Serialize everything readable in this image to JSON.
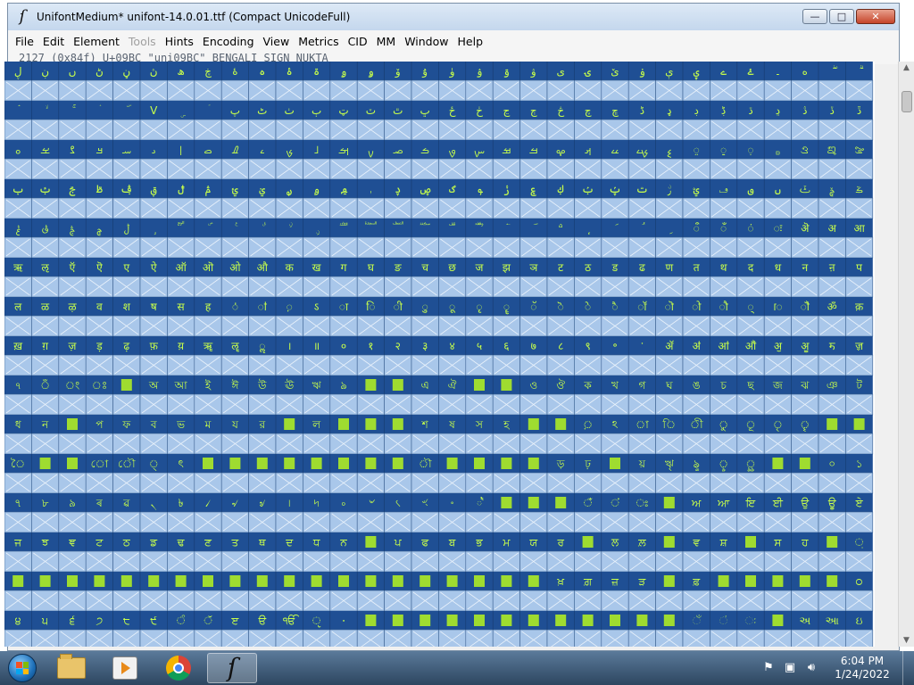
{
  "window": {
    "title": "UnifontMedium*  unifont-14.0.01.ttf (Compact UnicodeFull)",
    "app_icon": "fontforge-icon",
    "controls": {
      "minimize": "—",
      "maximize": "□",
      "close": "✕"
    }
  },
  "menu": [
    {
      "label": "File",
      "enabled": true
    },
    {
      "label": "Edit",
      "enabled": true
    },
    {
      "label": "Element",
      "enabled": true
    },
    {
      "label": "Tools",
      "enabled": false
    },
    {
      "label": "Hints",
      "enabled": true
    },
    {
      "label": "Encoding",
      "enabled": true
    },
    {
      "label": "View",
      "enabled": true
    },
    {
      "label": "Metrics",
      "enabled": true
    },
    {
      "label": "CID",
      "enabled": true
    },
    {
      "label": "MM",
      "enabled": true
    },
    {
      "label": "Window",
      "enabled": true
    },
    {
      "label": "Help",
      "enabled": true
    }
  ],
  "info_line": "2127 (0x84f) U+09BC \"uni09BC\" BENGALI SIGN NUKTA",
  "colors": {
    "row_dark": "#1f4f94",
    "cell_light": "#a9c7ea",
    "glyph_fg": "#c8ff4a",
    "missing_box": "#9fdc30",
    "grid_line": "#3a5f90"
  },
  "grid": {
    "columns": 32,
    "rows": [
      [
        "ڸ",
        "ڹ",
        "ں",
        "ڻ",
        "ڼ",
        "ڽ",
        "ھ",
        "ڿ",
        "ۀ",
        "ہ",
        "ۂ",
        "ۃ",
        "ۄ",
        "ۅ",
        "ۆ",
        "ۇ",
        "ۈ",
        "ۉ",
        "ۊ",
        "ۋ",
        "ی",
        "ۍ",
        "ێ",
        "ۏ",
        "ې",
        "ۑ",
        "ے",
        "ۓ",
        "۔",
        "ە",
        "ۖ",
        "ۗ"
      ],
      [
        "ۘ",
        "ۙ",
        "ۚ",
        "ۛ",
        "ۜ",
        "V",
        "ۣ",
        "ۤ",
        "پ",
        "ٹ",
        "ٺ",
        "ٻ",
        "ټ",
        "ٽ",
        "ٿ",
        "ڀ",
        "ځ",
        "ڂ",
        "ڃ",
        "ڄ",
        "څ",
        "چ",
        "ڇ",
        "ڈ",
        "ډ",
        "ڊ",
        "ڋ",
        "ڌ",
        "ڍ",
        "ڎ",
        "ڏ",
        "ڐ"
      ],
      [
        "ࡀ",
        "ࡁ",
        "ࡂ",
        "ࡃ",
        "ࡄ",
        "ࡅ",
        "ࡆ",
        "ࡇ",
        "ࡈ",
        "ࡉ",
        "ࡊ",
        "ࡋ",
        "ࡌ",
        "ࡍ",
        "ࡎ",
        "ࡏ",
        "ࡐ",
        "ࡑ",
        "ࡒ",
        "ࡓ",
        "ࡔ",
        "ࡕ",
        "ࡖ",
        "ࡗ",
        "ࡘ",
        "࡙",
        "࡚",
        "࡛",
        "࡞",
        "ࡠ",
        "ࡡ",
        "ࡢ"
      ],
      [
        "ࢠ",
        "ࢡ",
        "ࢢ",
        "ࢣ",
        "ࢤ",
        "ࢥ",
        "ࢦ",
        "ࢧ",
        "ࢨ",
        "ࢩ",
        "ࢪ",
        "ࢫ",
        "ࢬ",
        "ࢭ",
        "ࢮ",
        "ࢯ",
        "ࢰ",
        "ࢱ",
        "ࢲ",
        "ࢳ",
        "ࢴ",
        "ࢶ",
        "ࢷ",
        "ࢸ",
        "ࢹ",
        "ࢺ",
        "ࢻ",
        "ࢼ",
        "ࢽ",
        "ࣀ",
        "ࣁ",
        "ࣂ"
      ],
      [
        "ࣃ",
        "ࣄ",
        "ࣅ",
        "ࣆ",
        "ࣇ",
        "࣓",
        "ࣔ",
        "ࣕ",
        "ࣖ",
        "ࣗ",
        "ࣘ",
        "ࣙ",
        "ࣚ",
        "ࣛ",
        "ࣜ",
        "ࣝ",
        "ࣞ",
        "ࣟ",
        "࣠",
        "࣡",
        "࣢",
        "ࣣ",
        "ࣤ",
        "ࣥ",
        "ࣦ",
        "ऀ",
        "ँ",
        "ं",
        "ः",
        "ऄ",
        "अ",
        "आ"
      ],
      [
        "ऋ",
        "ऌ",
        "ऍ",
        "ऎ",
        "ए",
        "ऐ",
        "ऑ",
        "ऒ",
        "ओ",
        "औ",
        "क",
        "ख",
        "ग",
        "घ",
        "ङ",
        "च",
        "छ",
        "ज",
        "झ",
        "ञ",
        "ट",
        "ठ",
        "ड",
        "ढ",
        "ण",
        "त",
        "थ",
        "द",
        "ध",
        "न",
        "ऩ",
        "प"
      ],
      [
        "ल",
        "ळ",
        "ऴ",
        "व",
        "श",
        "ष",
        "स",
        "ह",
        "ऺ",
        "ऻ",
        "़",
        "ऽ",
        "ा",
        "ि",
        "ी",
        "ु",
        "ू",
        "ृ",
        "ॄ",
        "ॅ",
        "ॆ",
        "े",
        "ै",
        "ॉ",
        "ॊ",
        "ो",
        "ौ",
        "्",
        "ॎ",
        "ॏ",
        "ॐ",
        "क़"
      ],
      [
        "ख़",
        "ग़",
        "ज़",
        "ड़",
        "ढ़",
        "फ़",
        "य़",
        "ॠ",
        "ॡ",
        "ॢ",
        "।",
        "॥",
        "०",
        "१",
        "२",
        "३",
        "४",
        "५",
        "६",
        "७",
        "८",
        "९",
        "॰",
        "ॱ",
        "ॲ",
        "ॳ",
        "ॴ",
        "ॵ",
        "ॶ",
        "ॷ",
        "ॸ",
        "ॹ"
      ],
      [
        "ঀ",
        "ঁ",
        "ং",
        "ঃ",
        "",
        "অ",
        "আ",
        "ই",
        "ঈ",
        "উ",
        "ঊ",
        "ঋ",
        "ঌ",
        "",
        "",
        "এ",
        "ঐ",
        "",
        "",
        "ও",
        "ঔ",
        "ক",
        "খ",
        "গ",
        "ঘ",
        "ঙ",
        "চ",
        "ছ",
        "জ",
        "ঝ",
        "ঞ",
        "ট"
      ],
      [
        "ধ",
        "ন",
        "",
        "প",
        "ফ",
        "ব",
        "ভ",
        "ম",
        "য",
        "র",
        "",
        "ল",
        "",
        "",
        "",
        "শ",
        "ষ",
        "স",
        "হ",
        "",
        "",
        "়",
        "ঽ",
        "া",
        "ি",
        "ী",
        "ু",
        "ূ",
        "ৃ",
        "ৄ",
        "",
        "",
        "ে"
      ],
      [
        "ৈ",
        "",
        "",
        "ো",
        "ৌ",
        "্",
        "ৎ",
        "",
        "",
        "",
        "",
        "",
        "",
        "",
        "",
        "ৗ",
        "",
        "",
        "",
        "",
        "ড়",
        "ঢ়",
        "",
        "য়",
        "ৠ",
        "ৡ",
        "ৢ",
        "ৣ",
        "",
        "",
        "০",
        "১"
      ],
      [
        "৭",
        "৮",
        "৯",
        "ৰ",
        "ৱ",
        "৲",
        "৳",
        "৴",
        "৵",
        "৶",
        "৷",
        "৸",
        "৹",
        "৺",
        "৻",
        "ৼ",
        "৽",
        "৾",
        "",
        "",
        "",
        "ਁ",
        "ਂ",
        "ਃ",
        "",
        "ਅ",
        "ਆ",
        "ਇ",
        "ਈ",
        "ਉ",
        "ਊ",
        "ਏ"
      ],
      [
        "ਜ",
        "ਝ",
        "ਞ",
        "ਟ",
        "ਠ",
        "ਡ",
        "ਢ",
        "ਣ",
        "ਤ",
        "ਥ",
        "ਦ",
        "ਧ",
        "ਨ",
        "",
        "ਪ",
        "ਫ",
        "ਬ",
        "ਭ",
        "ਮ",
        "ਯ",
        "ਰ",
        "",
        "ਲ",
        "ਲ਼",
        "",
        "ਵ",
        "ਸ਼",
        "",
        "ਸ",
        "ਹ",
        "",
        "਼"
      ],
      [
        "",
        "",
        "",
        "",
        "",
        "",
        "",
        "",
        "",
        "",
        "",
        "",
        "",
        "",
        "",
        "",
        "",
        "",
        "",
        "",
        "ਖ਼",
        "ਗ਼",
        "ਜ਼",
        "ੜ",
        "",
        "ਫ਼",
        "",
        "",
        "",
        "",
        "",
        "੦"
      ],
      [
        "੪",
        "੫",
        "੬",
        "੭",
        "੮",
        "੯",
        "ੰ",
        "ੱ",
        "ੲ",
        "ੳ",
        "ੴ",
        "ੵ",
        "੶",
        "",
        "",
        "",
        "",
        "",
        "",
        "",
        "",
        "",
        "",
        "",
        "",
        "ઁ",
        "ં",
        "ઃ",
        "",
        "અ",
        "આ",
        "ઇ"
      ]
    ]
  },
  "taskbar": {
    "start_icon": "windows-start-icon",
    "apps": [
      {
        "name": "explorer",
        "icon": "folder-icon",
        "active": false
      },
      {
        "name": "media-player",
        "icon": "media-player-icon",
        "active": false
      },
      {
        "name": "chrome",
        "icon": "chrome-icon",
        "active": false
      },
      {
        "name": "fontforge",
        "icon": "fontforge-icon",
        "active": true
      }
    ],
    "clock_time": "6:04 PM",
    "clock_date": "1/24/2022"
  }
}
